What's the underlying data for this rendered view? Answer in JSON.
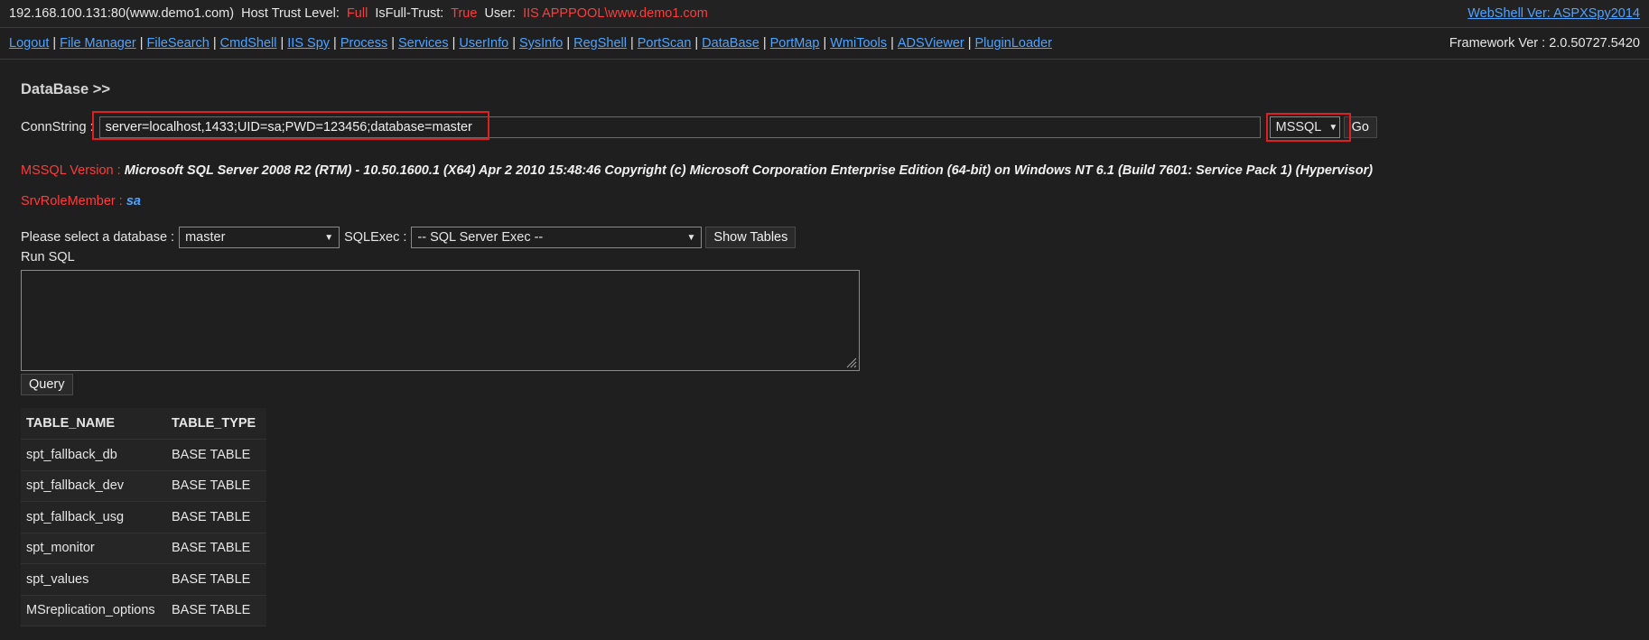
{
  "header": {
    "host": "192.168.100.131:80(www.demo1.com)",
    "trust_label": "Host Trust Level:",
    "trust_value": "Full",
    "fulltrust_label": "IsFull-Trust:",
    "fulltrust_value": "True",
    "user_label": "User:",
    "user_value": "IIS APPPOOL\\www.demo1.com",
    "version_link": "WebShell Ver: ASPXSpy2014"
  },
  "nav": {
    "items": [
      "Logout",
      "File Manager",
      "FileSearch",
      "CmdShell",
      "IIS Spy",
      "Process",
      "Services",
      "UserInfo",
      "SysInfo",
      "RegShell",
      "PortScan",
      "DataBase",
      "PortMap",
      "WmiTools",
      "ADSViewer",
      "PluginLoader"
    ],
    "framework": "Framework Ver : 2.0.50727.5420"
  },
  "page": {
    "title": "DataBase >>",
    "conn_label": "ConnString :",
    "conn_value": "server=localhost,1433;UID=sa;PWD=123456;database=master",
    "db_type": "MSSQL",
    "go_label": "Go",
    "version_label": "MSSQL Version :",
    "version_value": "Microsoft SQL Server 2008 R2 (RTM) - 10.50.1600.1 (X64) Apr 2 2010 15:48:46 Copyright (c) Microsoft Corporation Enterprise Edition (64-bit) on Windows NT 6.1 (Build 7601: Service Pack 1) (Hypervisor)",
    "role_label": "SrvRoleMember :",
    "role_value": "sa",
    "select_db_label": "Please select a database :",
    "select_db_value": "master",
    "sqlexec_label": "SQLExec :",
    "sqlexec_value": "-- SQL Server Exec --",
    "show_tables_label": "Show Tables",
    "run_sql_label": "Run SQL",
    "query_label": "Query"
  },
  "table": {
    "headers": [
      "TABLE_NAME",
      "TABLE_TYPE"
    ],
    "rows": [
      [
        "spt_fallback_db",
        "BASE TABLE"
      ],
      [
        "spt_fallback_dev",
        "BASE TABLE"
      ],
      [
        "spt_fallback_usg",
        "BASE TABLE"
      ],
      [
        "spt_monitor",
        "BASE TABLE"
      ],
      [
        "spt_values",
        "BASE TABLE"
      ],
      [
        "MSreplication_options",
        "BASE TABLE"
      ]
    ]
  },
  "icons": {
    "dropdown": "chevron-down-icon",
    "resize": "resize-handle-icon"
  },
  "colors": {
    "background": "#1f1f1f",
    "link": "#4ea3ff",
    "alert": "#ff3b3b",
    "highlight_box": "#e02020"
  }
}
